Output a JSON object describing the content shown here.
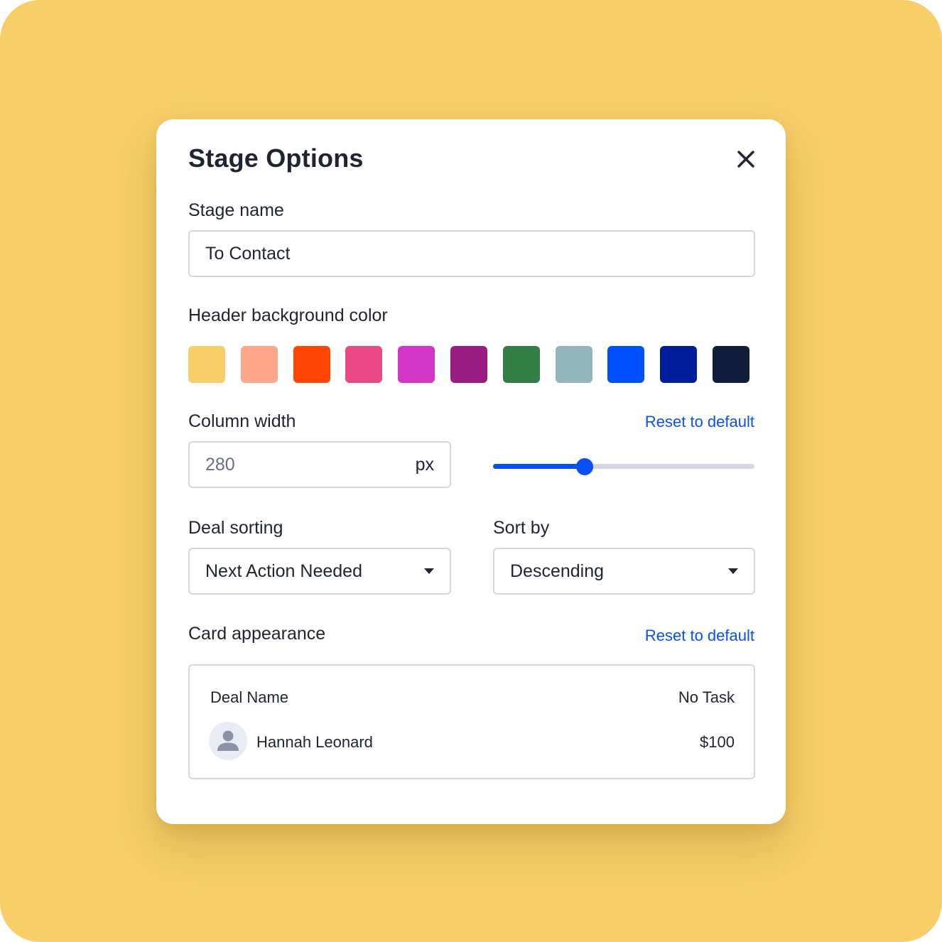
{
  "dialog": {
    "title": "Stage Options",
    "close_icon": "close-icon"
  },
  "stage_name": {
    "label": "Stage name",
    "value": "To Contact"
  },
  "header_color": {
    "label": "Header background color",
    "swatches": [
      "#F7CE68",
      "#FFA58A",
      "#FF4405",
      "#EB4886",
      "#D136C5",
      "#9A1E82",
      "#337D46",
      "#93B4BD",
      "#0050FF",
      "#001D9C",
      "#0F1C3A"
    ]
  },
  "column_width": {
    "label": "Column width",
    "reset_label": "Reset to default",
    "value": "280",
    "unit": "px",
    "slider_fraction": 0.35
  },
  "deal_sorting": {
    "label": "Deal sorting",
    "selected": "Next Action Needed"
  },
  "sort_by": {
    "label": "Sort by",
    "selected": "Descending"
  },
  "card_appearance": {
    "label": "Card appearance",
    "reset_label": "Reset to default",
    "preview": {
      "deal_name": "Deal Name",
      "task_status": "No Task",
      "person": "Hannah Leonard",
      "amount": "$100",
      "avatar_icon": "person-icon"
    }
  },
  "colors": {
    "accent": "#0A4FF5",
    "backdrop": "#F7CE68",
    "border": "#D3D7DF"
  }
}
